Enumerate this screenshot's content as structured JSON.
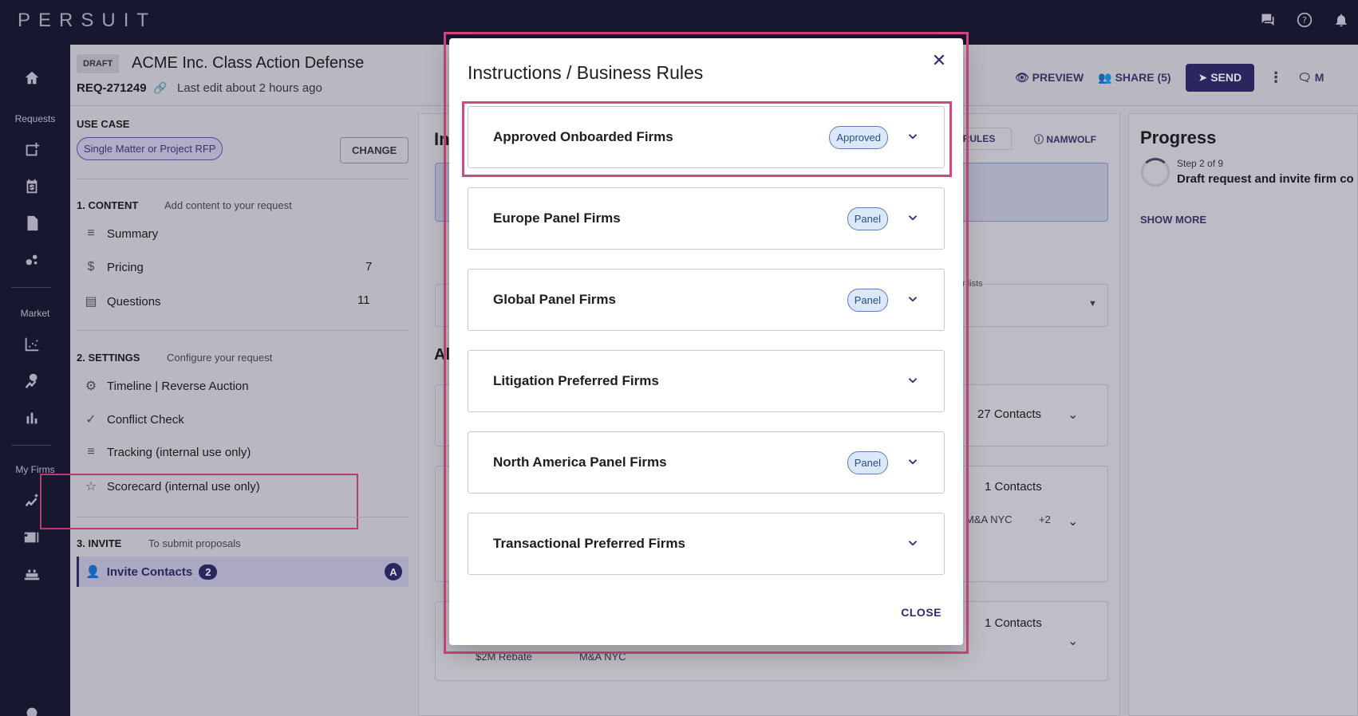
{
  "topbar": {
    "logo": "PERSUIT"
  },
  "nav": {
    "requests_label": "Requests",
    "market_label": "Market",
    "myfirms_label": "My Firms"
  },
  "header": {
    "badge": "DRAFT",
    "title": "ACME Inc. Class Action Defense",
    "req_id": "REQ-271249",
    "last_edit": "Last edit about 2 hours ago",
    "preview": "PREVIEW",
    "share": "SHARE (5)",
    "send": "SEND",
    "m_partial": "M"
  },
  "leftpanel": {
    "use_case_label": "USE CASE",
    "use_case_value": "Single Matter or Project RFP",
    "change": "CHANGE",
    "content_label": "1. CONTENT",
    "content_sub": "Add content to your request",
    "summary": "Summary",
    "pricing": "Pricing",
    "pricing_count": "7",
    "questions": "Questions",
    "questions_count": "11",
    "settings_label": "2. SETTINGS",
    "settings_sub": "Configure your request",
    "timeline": "Timeline | Reverse Auction",
    "conflict": "Conflict Check",
    "tracking": "Tracking (internal use only)",
    "scorecard": "Scorecard (internal use only)",
    "invite_label": "3. INVITE",
    "invite_sub": "To submit proposals",
    "invite_contacts": "Invite Contacts",
    "invite_count": "2",
    "invite_a": "A"
  },
  "center": {
    "partial_in": "In",
    "partial_al": "Al",
    "rules_btn": "RULES",
    "namwolf": "NAMWOLF",
    "lists_label": "r lists",
    "contacts_1": "27 Contacts",
    "contacts_2": "1 Contacts",
    "tag_ma": "M&A NYC",
    "plus_more": "+2",
    "contacts_3": "1 Contacts",
    "tag_rebate": "$2M Rebate",
    "tag_ma2": "M&A NYC"
  },
  "progress": {
    "title": "Progress",
    "step": "Step 2 of 9",
    "desc": "Draft request and invite firm co",
    "show_more": "SHOW MORE"
  },
  "modal": {
    "title": "Instructions / Business Rules",
    "close_label": "CLOSE",
    "rules": [
      {
        "name": "Approved Onboarded Firms",
        "badge": "Approved"
      },
      {
        "name": "Europe Panel Firms",
        "badge": "Panel"
      },
      {
        "name": "Global Panel Firms",
        "badge": "Panel"
      },
      {
        "name": "Litigation Preferred Firms",
        "badge": ""
      },
      {
        "name": "North America Panel Firms",
        "badge": "Panel"
      },
      {
        "name": "Transactional Preferred Firms",
        "badge": ""
      }
    ]
  }
}
